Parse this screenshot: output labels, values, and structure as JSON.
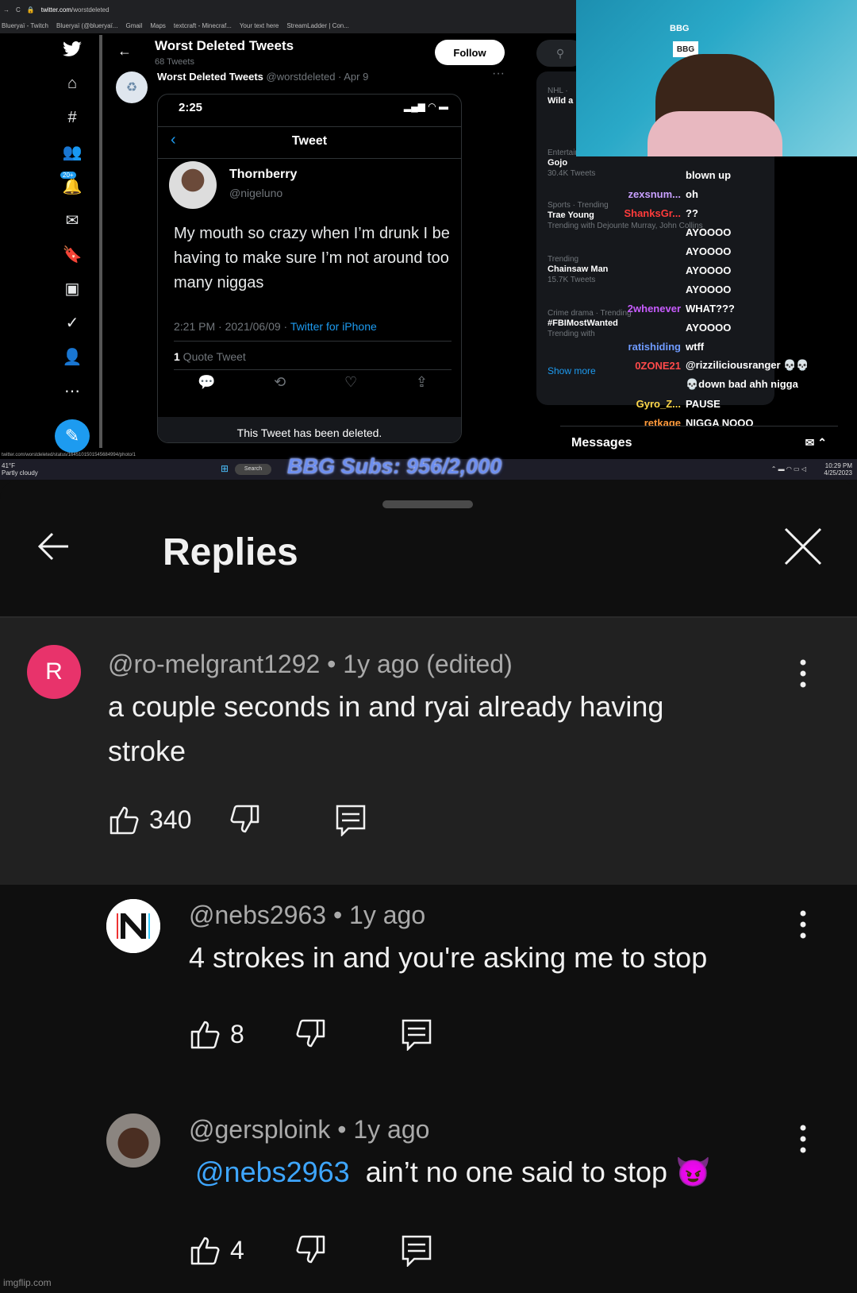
{
  "stream": {
    "browser": {
      "url_host": "twitter.com",
      "url_path": "/worstdeleted",
      "bookmarks": [
        "Blueryaï - Twitch",
        "Blueryaï (@blueryaï...",
        "Gmail",
        "Maps",
        "textcraft - Minecraf...",
        "Your text here",
        "StreamLadder | Con..."
      ]
    },
    "twitter": {
      "header_title": "Worst Deleted Tweets",
      "header_count": "68 Tweets",
      "follow_label": "Follow",
      "nav_badge": "20+",
      "post_author": "Worst Deleted Tweets",
      "post_handle_date": "@worstdeleted · Apr 9",
      "phone": {
        "time": "2:25",
        "screen_title": "Tweet",
        "name": "Thornberry",
        "handle": "@nigeluno",
        "text": "My mouth so crazy when I’m drunk I be having to make sure I’m not around too many niggas",
        "meta_time": "2:21 PM · 2021/06/09 · ",
        "meta_source": "Twitter for iPhone",
        "quote_count": "1",
        "quote_label": " Quote Tweet",
        "deleted_notice": "This Tweet has been deleted."
      },
      "trends": [
        {
          "category": "NHL ·",
          "name": "Wild a"
        },
        {
          "category": "Entertainment · Trending",
          "name": "Gojo",
          "count": "30.4K Tweets"
        },
        {
          "category": "Sports · Trending",
          "name": "Trae Young",
          "count": "Trending with Dejounte Murray, John Collins"
        },
        {
          "category": "Trending",
          "name": "Chainsaw Man",
          "count": "15.7K Tweets"
        },
        {
          "category": "Crime drama · Trending",
          "name": "#FBIMostWanted",
          "count": "Trending with"
        }
      ],
      "show_more": "Show more",
      "messages_label": "Messages",
      "status_url": "twitter.com/worstdeleted/status/1645101501545684994/photo/1"
    },
    "webcam": {
      "banner": "BBG",
      "logo": "BBG"
    },
    "chat": [
      {
        "user": "",
        "msg": "blown up",
        "color": "#ffffff"
      },
      {
        "user": "zexsnum...",
        "msg": "oh",
        "color": "#c9a0ff"
      },
      {
        "user": "ShanksGr...",
        "msg": "??",
        "color": "#ff3b3b"
      },
      {
        "user": "",
        "msg": "AYOOOO",
        "color": "#ffffff"
      },
      {
        "user": "",
        "msg": "AYOOOO",
        "color": "#ffffff"
      },
      {
        "user": "",
        "msg": "AYOOOO",
        "color": "#ffffff"
      },
      {
        "user": "",
        "msg": "AYOOOO",
        "color": "#ffffff"
      },
      {
        "user": "2whenever",
        "msg": "WHAT???",
        "color": "#c85cff"
      },
      {
        "user": "",
        "msg": "AYOOOO",
        "color": "#ffffff"
      },
      {
        "user": "ratishiding",
        "msg": "wtff",
        "color": "#6f9bff"
      },
      {
        "user": "0ZONE21",
        "msg": "@rizziliciousranger 💀💀",
        "color": "#ff4a4a"
      },
      {
        "user": "",
        "msg": "💀down bad ahh nigga",
        "color": "#ffffff"
      },
      {
        "user": "Gyro_Z...",
        "msg": "PAUSE",
        "color": "#ffd84a"
      },
      {
        "user": "retkage",
        "msg": "NIGGA NOOO",
        "color": "#ff9a3b"
      }
    ],
    "taskbar": {
      "weather_temp": "41°F",
      "weather_desc": "Partly cloudy",
      "search_label": "Search",
      "subs_goal": "BBG Subs: 956/2,000",
      "time": "10:29 PM",
      "date": "4/25/2023"
    }
  },
  "replies": {
    "title": "Replies",
    "parent": {
      "avatar_letter": "R",
      "author": "@ro-melgrant1292",
      "age": "1y ago (edited)",
      "text": "a couple seconds in and ryai already having stroke",
      "likes": "340"
    },
    "items": [
      {
        "author": "@nebs2963",
        "age": "1y ago",
        "mention": "",
        "text": "4 strokes in and you're asking me to stop",
        "likes": "8"
      },
      {
        "author": "@gersploink",
        "age": "1y ago",
        "mention": "@nebs2963",
        "text": "ain’t no one said to stop 😈",
        "likes": "4"
      }
    ],
    "separator": " • "
  },
  "watermark": "imgflip.com",
  "colors": {
    "mention": "#3ea6ff",
    "avatar_r": "#e8336b",
    "twitter_blue": "#1d9bf0"
  }
}
